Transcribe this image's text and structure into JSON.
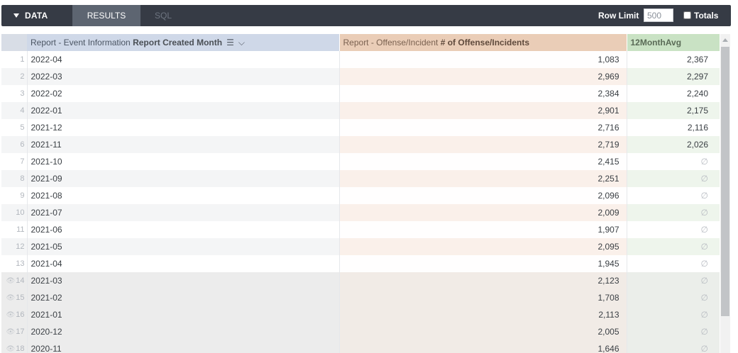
{
  "toolbar": {
    "data_label": "DATA",
    "tabs": [
      {
        "label": "RESULTS",
        "active": true
      },
      {
        "label": "SQL",
        "active": false
      }
    ],
    "row_limit_label": "Row Limit",
    "row_limit_value": "500",
    "totals_label": "Totals",
    "totals_checked": false
  },
  "table": {
    "headers": {
      "month_prefix": "Report - Event Information ",
      "month_bold": "Report Created Month",
      "offense_prefix": "Report - Offense/Incident ",
      "offense_bold": "# of Offense/Incidents",
      "avg": "12MonthAvg"
    },
    "null_symbol": "∅",
    "rows": [
      {
        "index": "1",
        "month": "2022-04",
        "offenses": "1,083",
        "avg": "2,367",
        "hidden": false
      },
      {
        "index": "2",
        "month": "2022-03",
        "offenses": "2,969",
        "avg": "2,297",
        "hidden": false
      },
      {
        "index": "3",
        "month": "2022-02",
        "offenses": "2,384",
        "avg": "2,240",
        "hidden": false
      },
      {
        "index": "4",
        "month": "2022-01",
        "offenses": "2,901",
        "avg": "2,175",
        "hidden": false
      },
      {
        "index": "5",
        "month": "2021-12",
        "offenses": "2,716",
        "avg": "2,116",
        "hidden": false
      },
      {
        "index": "6",
        "month": "2021-11",
        "offenses": "2,719",
        "avg": "2,026",
        "hidden": false
      },
      {
        "index": "7",
        "month": "2021-10",
        "offenses": "2,415",
        "avg": "∅",
        "hidden": false
      },
      {
        "index": "8",
        "month": "2021-09",
        "offenses": "2,251",
        "avg": "∅",
        "hidden": false
      },
      {
        "index": "9",
        "month": "2021-08",
        "offenses": "2,096",
        "avg": "∅",
        "hidden": false
      },
      {
        "index": "10",
        "month": "2021-07",
        "offenses": "2,009",
        "avg": "∅",
        "hidden": false
      },
      {
        "index": "11",
        "month": "2021-06",
        "offenses": "1,907",
        "avg": "∅",
        "hidden": false
      },
      {
        "index": "12",
        "month": "2021-05",
        "offenses": "2,095",
        "avg": "∅",
        "hidden": false
      },
      {
        "index": "13",
        "month": "2021-04",
        "offenses": "1,945",
        "avg": "∅",
        "hidden": false
      },
      {
        "index": "14",
        "month": "2021-03",
        "offenses": "2,123",
        "avg": "∅",
        "hidden": true
      },
      {
        "index": "15",
        "month": "2021-02",
        "offenses": "1,708",
        "avg": "∅",
        "hidden": true
      },
      {
        "index": "16",
        "month": "2021-01",
        "offenses": "2,113",
        "avg": "∅",
        "hidden": true
      },
      {
        "index": "17",
        "month": "2020-12",
        "offenses": "2,005",
        "avg": "∅",
        "hidden": true
      },
      {
        "index": "18",
        "month": "2020-11",
        "offenses": "1,646",
        "avg": "∅",
        "hidden": true
      }
    ]
  }
}
